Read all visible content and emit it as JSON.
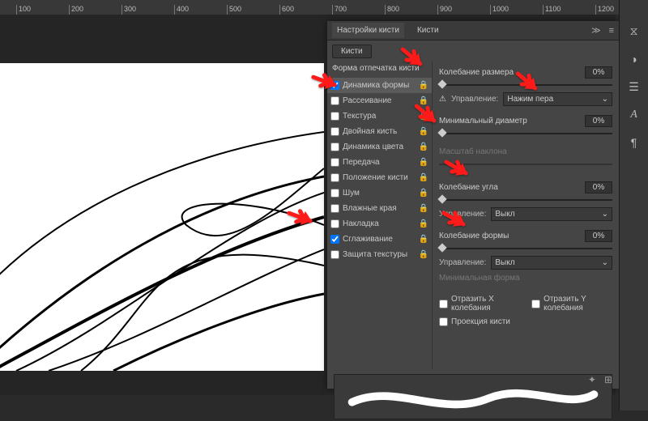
{
  "ruler_marks": [
    "100",
    "200",
    "300",
    "400",
    "500",
    "600",
    "700",
    "800",
    "900",
    "1000",
    "1100",
    "1200"
  ],
  "panel": {
    "tab_active": "Настройки кисти",
    "tab_other": "Кисти",
    "top_button": "Кисти",
    "brush_shape_header": "Форма отпечатка кисти",
    "options": [
      {
        "label": "Динамика формы",
        "checked": true,
        "lock": true,
        "active": true
      },
      {
        "label": "Рассеивание",
        "checked": false,
        "lock": true
      },
      {
        "label": "Текстура",
        "checked": false,
        "lock": true
      },
      {
        "label": "Двойная кисть",
        "checked": false,
        "lock": true
      },
      {
        "label": "Динамика цвета",
        "checked": false,
        "lock": true
      },
      {
        "label": "Передача",
        "checked": false,
        "lock": true
      },
      {
        "label": "Положение кисти",
        "checked": false,
        "lock": true
      },
      {
        "label": "Шум",
        "checked": false,
        "lock": true
      },
      {
        "label": "Влажные края",
        "checked": false,
        "lock": true
      },
      {
        "label": "Накладка",
        "checked": false,
        "lock": true
      },
      {
        "label": "Сглаживание",
        "checked": true,
        "lock": true
      },
      {
        "label": "Защита текстуры",
        "checked": false,
        "lock": true
      }
    ],
    "size_jitter": {
      "label": "Колебание размера",
      "value": "0%"
    },
    "size_control": {
      "label": "Управление:",
      "value": "Нажим пера"
    },
    "min_diameter": {
      "label": "Минимальный диаметр",
      "value": "0%"
    },
    "tilt_scale": {
      "label": "Масштаб наклона"
    },
    "angle_jitter": {
      "label": "Колебание угла",
      "value": "0%"
    },
    "angle_control": {
      "label": "Управление:",
      "value": "Выкл"
    },
    "round_jitter": {
      "label": "Колебание формы",
      "value": "0%"
    },
    "round_control": {
      "label": "Управление:",
      "value": "Выкл"
    },
    "min_round": {
      "label": "Минимальная форма"
    },
    "flip_x": "Отразить X колебания",
    "flip_y": "Отразить Y колебания",
    "brush_proj": "Проекция кисти"
  },
  "right_icons": [
    "history-icon",
    "adjustments-icon",
    "styles-icon",
    "libraries-icon",
    "type-icon",
    "paragraph-icon"
  ]
}
